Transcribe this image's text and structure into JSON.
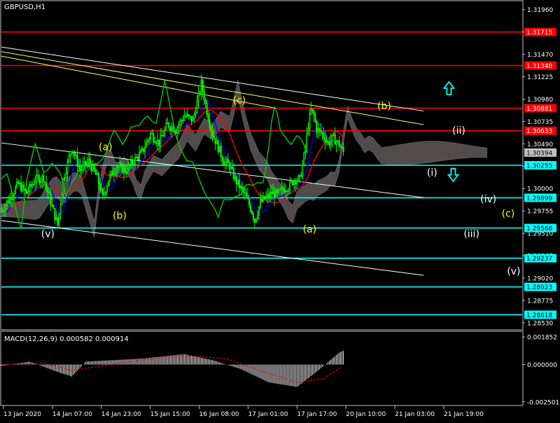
{
  "window": {
    "symbol_title": "GBPUSD,H1",
    "macd_title": "MACD(12,26,9) 0.000582 0.000914"
  },
  "colors": {
    "background": "#000000",
    "frame": "#c0c0c0",
    "candle": "#00ff00",
    "horizontal_red": "#ff0000",
    "horizontal_cyan": "#00ffff",
    "trend_white": "#ffffff",
    "trend_yellow": "#ffff66",
    "ma_red": "#ff0000",
    "ma_blue": "#0000ff",
    "chikou_green": "#00cc00",
    "cloud": "#e8d8d8",
    "wave_yellow": "#ffff00",
    "wave_white": "#ffffff",
    "arrow_cyan": "#00ffff",
    "macd_hist": "#ffffff",
    "macd_signal": "#ff0000"
  },
  "chart_data": {
    "type": "candlestick",
    "instrument": "GBPUSD",
    "timeframe": "H1",
    "x_tick_labels": [
      "13 Jan 2020",
      "14 Jan 07:00",
      "14 Jan 23:00",
      "15 Jan 15:00",
      "16 Jan 08:00",
      "17 Jan 01:00",
      "17 Jan 17:00",
      "20 Jan 10:00",
      "21 Jan 03:00",
      "21 Jan 19:00"
    ],
    "y_tick_labels": [
      "1.31960",
      "1.31715",
      "1.31470",
      "1.31225",
      "1.30980",
      "1.30735",
      "1.30490",
      "1.30245",
      "1.30000",
      "1.29755",
      "1.29510",
      "1.29265",
      "1.29020",
      "1.28775",
      "1.28530"
    ],
    "ylim": [
      1.2846,
      1.3205
    ],
    "grid": false,
    "price_path": [
      [
        0,
        1.2975
      ],
      [
        6,
        1.299
      ],
      [
        12,
        1.3005
      ],
      [
        18,
        1.2995
      ],
      [
        24,
        1.301
      ],
      [
        30,
        1.3012
      ],
      [
        36,
        1.298
      ],
      [
        40,
        1.296
      ],
      [
        44,
        1.301
      ],
      [
        50,
        1.3045
      ],
      [
        56,
        1.302
      ],
      [
        62,
        1.303
      ],
      [
        68,
        1.3012
      ],
      [
        72,
        1.299
      ],
      [
        76,
        1.301
      ],
      [
        82,
        1.3025
      ],
      [
        88,
        1.302
      ],
      [
        94,
        1.303
      ],
      [
        100,
        1.304
      ],
      [
        106,
        1.306
      ],
      [
        112,
        1.305
      ],
      [
        118,
        1.307
      ],
      [
        124,
        1.3065
      ],
      [
        130,
        1.308
      ],
      [
        136,
        1.3075
      ],
      [
        140,
        1.31
      ],
      [
        142,
        1.3115
      ],
      [
        146,
        1.3085
      ],
      [
        150,
        1.306
      ],
      [
        154,
        1.3045
      ],
      [
        158,
        1.303
      ],
      [
        162,
        1.3025
      ],
      [
        166,
        1.301
      ],
      [
        170,
        1.3
      ],
      [
        174,
        1.299
      ],
      [
        178,
        1.2975
      ],
      [
        180,
        1.2965
      ],
      [
        184,
        1.2985
      ],
      [
        188,
        1.299
      ],
      [
        192,
        1.2995
      ],
      [
        196,
        1.2993
      ],
      [
        200,
        1.3
      ],
      [
        204,
        1.3002
      ],
      [
        208,
        1.301
      ],
      [
        212,
        1.301
      ],
      [
        214,
        1.3025
      ],
      [
        216,
        1.3045
      ],
      [
        218,
        1.307
      ],
      [
        220,
        1.3085
      ],
      [
        222,
        1.308
      ],
      [
        224,
        1.3065
      ],
      [
        228,
        1.306
      ],
      [
        232,
        1.305
      ],
      [
        236,
        1.3055
      ],
      [
        240,
        1.3048
      ],
      [
        243,
        1.304
      ]
    ],
    "candle_count": 244,
    "horizontal_levels": [
      {
        "price": 1.31715,
        "label": "1.31715",
        "color": "#ff0000"
      },
      {
        "price": 1.31348,
        "label": "1.31348",
        "color": "#ff0000"
      },
      {
        "price": 1.30881,
        "label": "1.30881",
        "color": "#ff0000"
      },
      {
        "price": 1.30633,
        "label": "1.30633",
        "color": "#ff0000"
      },
      {
        "price": 1.30255,
        "label": "1.30255",
        "color": "#00ffff"
      },
      {
        "price": 1.29899,
        "label": "1.29899",
        "color": "#00ffff"
      },
      {
        "price": 1.29568,
        "label": "1.29568",
        "color": "#00ffff"
      },
      {
        "price": 1.29237,
        "label": "1.29237",
        "color": "#00ffff"
      },
      {
        "price": 1.28923,
        "label": "1.28923",
        "color": "#00ffff"
      },
      {
        "price": 1.28618,
        "label": "1.28618",
        "color": "#00ffff"
      }
    ],
    "current_price_label": "1.30394",
    "trendlines": [
      {
        "color": "#ffffff",
        "from": [
          0,
          1.3155
        ],
        "to": [
          300,
          1.3085
        ]
      },
      {
        "color": "#ffff66",
        "from": [
          0,
          1.315
        ],
        "to": [
          300,
          1.307
        ]
      },
      {
        "color": "#ffff66",
        "from": [
          0,
          1.3145
        ],
        "to": [
          195,
          1.3088
        ]
      },
      {
        "color": "#ffffff",
        "from": [
          0,
          1.305
        ],
        "to": [
          300,
          1.299
        ]
      },
      {
        "color": "#ffffff",
        "from": [
          0,
          1.2965
        ],
        "to": [
          300,
          1.2905
        ]
      }
    ],
    "wave_labels": [
      {
        "text": "(v)",
        "color": "#ffffff",
        "x": 33,
        "price": 1.295
      },
      {
        "text": "(a)",
        "color": "#ffff00",
        "x": 74,
        "price": 1.3045
      },
      {
        "text": "(b)",
        "color": "#ffff00",
        "x": 84,
        "price": 1.297
      },
      {
        "text": "(c)",
        "color": "#ffff00",
        "x": 169,
        "price": 1.3096
      },
      {
        "text": "(a)",
        "color": "#ffff00",
        "x": 219,
        "price": 1.2955
      },
      {
        "text": "(b)",
        "color": "#ffff00",
        "x": 272,
        "price": 1.309
      },
      {
        "text": "(ii)",
        "color": "#ffffff",
        "x": 325,
        "price": 1.3063
      },
      {
        "text": "(i)",
        "color": "#ffffff",
        "x": 306,
        "price": 1.3017
      },
      {
        "text": "(iv)",
        "color": "#ffffff",
        "x": 346,
        "price": 1.2988
      },
      {
        "text": "(c)",
        "color": "#ffff00",
        "x": 360,
        "price": 1.2972
      },
      {
        "text": "(iii)",
        "color": "#ffffff",
        "x": 334,
        "price": 1.295
      },
      {
        "text": "(v)",
        "color": "#ffffff",
        "x": 364,
        "price": 1.2909
      }
    ],
    "arrows": [
      {
        "direction": "up",
        "color": "#00ffff",
        "x": 318,
        "price": 1.311
      },
      {
        "direction": "down",
        "color": "#00ffff",
        "x": 321,
        "price": 1.3015
      }
    ],
    "macd": {
      "label": "MACD(12,26,9)",
      "main": 0.000582,
      "signal": 0.000914,
      "y_tick_labels": [
        "0.001852",
        "0.000000",
        "-0.002501"
      ],
      "ylim": [
        -0.0027,
        0.002
      ],
      "hist_path": [
        [
          0,
          -0.0001
        ],
        [
          20,
          0.0002
        ],
        [
          40,
          -0.0005
        ],
        [
          50,
          -0.0008
        ],
        [
          60,
          0.0002
        ],
        [
          80,
          0.0003
        ],
        [
          100,
          0.0004
        ],
        [
          130,
          0.0007
        ],
        [
          150,
          0.0003
        ],
        [
          170,
          -0.0003
        ],
        [
          190,
          -0.0012
        ],
        [
          210,
          -0.0015
        ],
        [
          225,
          -0.0004
        ],
        [
          240,
          0.0008
        ],
        [
          260,
          0.0017
        ],
        [
          280,
          0.0015
        ],
        [
          300,
          0.0006
        ]
      ],
      "signal_path": [
        [
          0,
          0.0
        ],
        [
          30,
          0.0001
        ],
        [
          50,
          -0.0004
        ],
        [
          70,
          -0.0001
        ],
        [
          100,
          0.0003
        ],
        [
          130,
          0.0006
        ],
        [
          160,
          0.0004
        ],
        [
          190,
          -0.0006
        ],
        [
          210,
          -0.0012
        ],
        [
          230,
          -0.0009
        ],
        [
          250,
          0.0004
        ],
        [
          270,
          0.0012
        ],
        [
          300,
          0.001
        ]
      ]
    }
  }
}
